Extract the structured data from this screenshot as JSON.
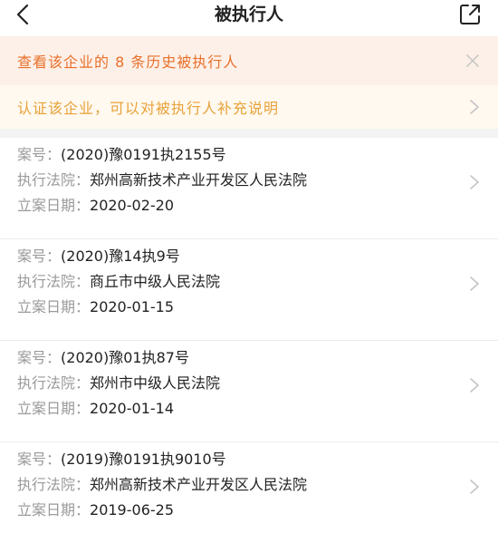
{
  "nav": {
    "title": "被执行人"
  },
  "banner": {
    "text": "查看该企业的 8 条历史被执行人"
  },
  "certify": {
    "text": "认证该企业，可以对被执行人补充说明"
  },
  "labels": {
    "case_no": "案号：",
    "court": "执行法院：",
    "date": "立案日期："
  },
  "records": [
    {
      "case_no": "(2020)豫0191执2155号",
      "court": "郑州高新技术产业开发区人民法院",
      "date": "2020-02-20"
    },
    {
      "case_no": "(2020)豫14执9号",
      "court": "商丘市中级人民法院",
      "date": "2020-01-15"
    },
    {
      "case_no": "(2020)豫01执87号",
      "court": "郑州市中级人民法院",
      "date": "2020-01-14"
    },
    {
      "case_no": "(2019)豫0191执9010号",
      "court": "郑州高新技术产业开发区人民法院",
      "date": "2019-06-25"
    }
  ],
  "colors": {
    "banner_text": "#e8702a",
    "banner_bg": "#fdf0e8",
    "cert_text": "#e8a23a",
    "cert_bg": "#fff9ef"
  },
  "icons": {
    "back": "chevron-left-icon",
    "share": "share-external-icon",
    "close": "close-icon",
    "row_arrow": "chevron-right-icon"
  }
}
